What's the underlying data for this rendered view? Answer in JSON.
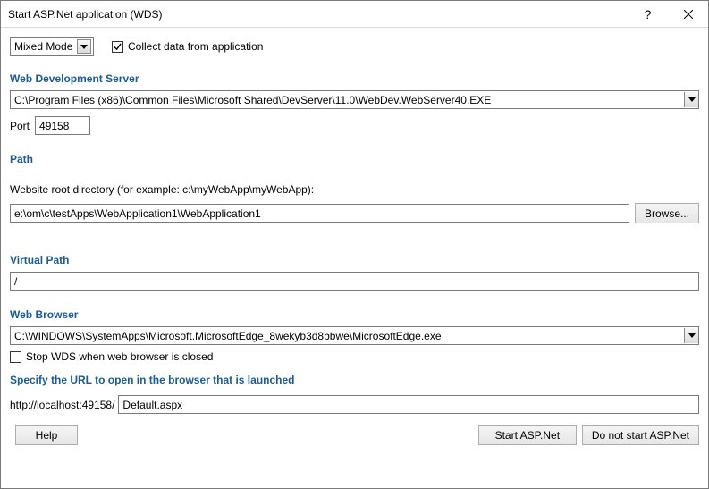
{
  "window": {
    "title": "Start ASP.Net application (WDS)"
  },
  "mode": {
    "selected": "Mixed Mode"
  },
  "collect": {
    "label": "Collect data from application",
    "checked": true
  },
  "headings": {
    "wds": "Web Development Server",
    "path": "Path",
    "virtual_path": "Virtual Path",
    "web_browser": "Web Browser",
    "url_spec": "Specify the URL to open in the browser that is launched"
  },
  "wds": {
    "executable": "C:\\Program Files (x86)\\Common Files\\Microsoft Shared\\DevServer\\11.0\\WebDev.WebServer40.EXE"
  },
  "port": {
    "label": "Port",
    "value": "49158"
  },
  "path_section": {
    "hint": "Website root directory (for example: c:\\myWebApp\\myWebApp):",
    "value": "e:\\om\\c\\testApps\\WebApplication1\\WebApplication1",
    "browse": "Browse..."
  },
  "virtual_path": {
    "value": "/"
  },
  "browser": {
    "executable": "C:\\WINDOWS\\SystemApps\\Microsoft.MicrosoftEdge_8wekyb3d8bbwe\\MicrosoftEdge.exe"
  },
  "stop_wds": {
    "label": "Stop WDS when web browser is closed",
    "checked": false
  },
  "url": {
    "static": "http://localhost:49158/",
    "page": "Default.aspx"
  },
  "buttons": {
    "help": "Help",
    "start": "Start ASP.Net",
    "do_not_start": "Do not start ASP.Net"
  }
}
